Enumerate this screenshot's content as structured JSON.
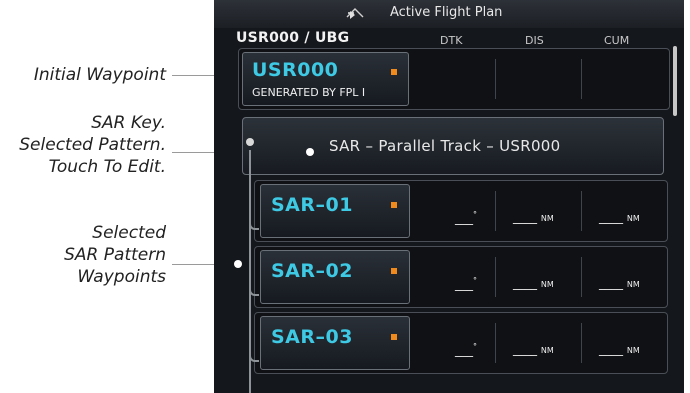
{
  "callouts": {
    "initial_waypoint": "Initial Waypoint",
    "sar_key": "SAR Key.\nSelected Pattern.\nTouch To Edit.",
    "sar_waypoints": "Selected\nSAR Pattern\nWaypoints"
  },
  "title_bar": {
    "title": "Active Flight Plan",
    "icon": "flight-plan-icon"
  },
  "header": {
    "route": "USR000 / UBG",
    "columns": [
      "DTK",
      "DIS",
      "CUM"
    ]
  },
  "initial_waypoint": {
    "name": "USR000",
    "subtitle": "GENERATED BY FPL I"
  },
  "sar_key": {
    "label": "SAR – Parallel Track – USR000"
  },
  "sar_waypoints": [
    {
      "name": "SAR–01",
      "dtk": "___",
      "dtk_unit": "°",
      "dis": "____",
      "dis_unit": "NM",
      "cum": "____",
      "cum_unit": "NM"
    },
    {
      "name": "SAR–02",
      "dtk": "___",
      "dtk_unit": "°",
      "dis": "____",
      "dis_unit": "NM",
      "cum": "____",
      "cum_unit": "NM"
    },
    {
      "name": "SAR–03",
      "dtk": "___",
      "dtk_unit": "°",
      "dis": "____",
      "dis_unit": "NM",
      "cum": "____",
      "cum_unit": "NM"
    }
  ],
  "colors": {
    "waypoint_text": "#3ec9e4",
    "marker": "#f08a1c",
    "screen_bg": "#14171c"
  }
}
